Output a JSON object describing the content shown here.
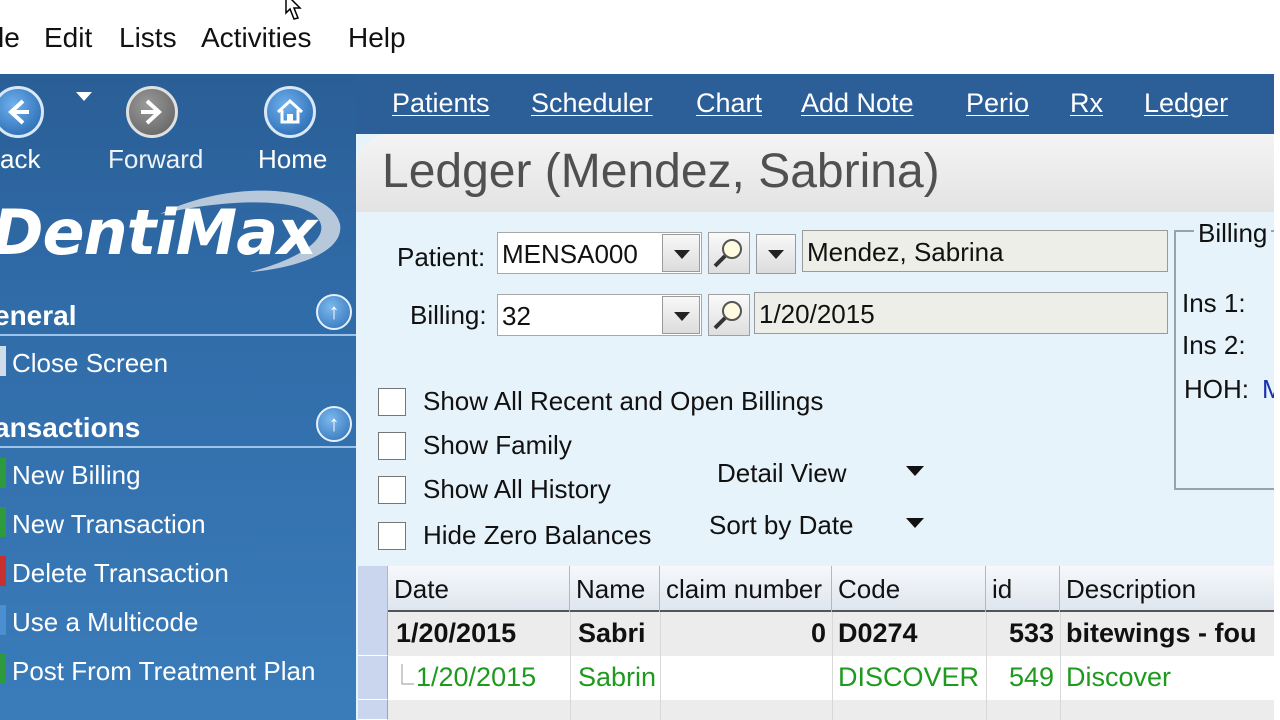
{
  "menu": [
    "le",
    "Edit",
    "Lists",
    "Activities",
    "Help"
  ],
  "nav": {
    "back_label": "ack",
    "forward_label": "Forward",
    "home_label": "Home"
  },
  "logo_text": "DentiMax",
  "sections": {
    "general": {
      "title": "eneral",
      "items": [
        "Close Screen"
      ]
    },
    "transactions": {
      "title": "ansactions",
      "items": [
        "New Billing",
        "New Transaction",
        "Delete Transaction",
        "Use a Multicode",
        "Post From Treatment Plan"
      ]
    }
  },
  "toolbar_links": [
    "Patients",
    "Scheduler",
    "Chart",
    "Add Note",
    "Perio",
    "Rx",
    "Ledger"
  ],
  "page_title": "Ledger (Mendez, Sabrina)",
  "form": {
    "patient_label": "Patient:",
    "patient_code": "MENSA000",
    "patient_name": "Mendez, Sabrina",
    "billing_label": "Billing:",
    "billing_number": "32",
    "billing_date": "1/20/2015"
  },
  "options": {
    "show_all_recent": "Show All Recent and Open Billings",
    "show_family": "Show Family",
    "show_all_history": "Show All History",
    "hide_zero": "Hide Zero Balances",
    "detail_view": "Detail View",
    "sort_by": "Sort by Date"
  },
  "billing_group": {
    "legend": "Billing",
    "ins1": "Ins 1:",
    "ins2": "Ins 2:",
    "hoh": "HOH:",
    "hoh_value": "M"
  },
  "grid": {
    "columns": [
      "Date",
      "Name",
      "claim number",
      "Code",
      "id",
      "Description"
    ],
    "rows": [
      {
        "date": "1/20/2015",
        "name": "Sabri",
        "claim": "0",
        "code": "D0274",
        "id": "533",
        "desc": "bitewings - fou"
      },
      {
        "date": "1/20/2015",
        "name": "Sabrin",
        "claim": "",
        "code": "DISCOVER",
        "id": "549",
        "desc": "Discover"
      }
    ]
  },
  "colors": {
    "sidebar": "#2f6aa6",
    "toolbar": "#2c5f98",
    "content_bg": "#e7f3fb",
    "insurance_row_text": "#1e9a1e"
  }
}
